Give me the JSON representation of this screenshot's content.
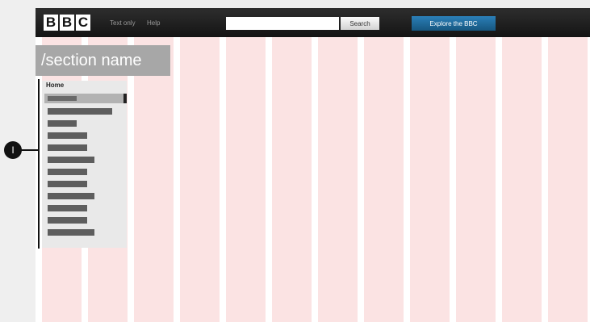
{
  "header": {
    "logo_letters": [
      "B",
      "B",
      "C"
    ],
    "links": [
      "Text only",
      "Help"
    ],
    "search": {
      "value": "",
      "placeholder": "",
      "button_label": "Search"
    },
    "explore_label": "Explore the BBC"
  },
  "section": {
    "title": "/section name"
  },
  "nav": {
    "home_label": "Home",
    "item_count": 13
  },
  "callout": {
    "label": "I"
  },
  "colors": {
    "page_background": "#efefef",
    "grid_column": "#fbe3e3",
    "topbar": "#1e1e1e",
    "explore_button": "#1f6a9b",
    "section_header": "#a7a7a7",
    "nav_panel": "#e9e9e9",
    "nav_bar": "#5e5e5e"
  },
  "icons": [
    "bbc-logo-icon",
    "callout-badge-icon"
  ]
}
